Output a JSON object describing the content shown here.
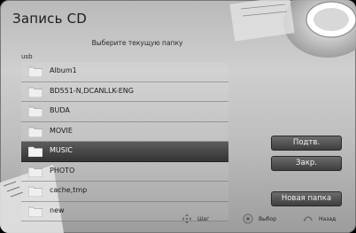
{
  "screen": {
    "title": "Запись CD",
    "subtitle": "Выберите текущую папку",
    "path": "usb"
  },
  "folders": [
    {
      "label": "Album1",
      "selected": false
    },
    {
      "label": "BD551-N,DCANLLK-ENG",
      "selected": false
    },
    {
      "label": "BUDA",
      "selected": false
    },
    {
      "label": "MOVIE",
      "selected": false
    },
    {
      "label": "MUSIC",
      "selected": true
    },
    {
      "label": "PHOTO",
      "selected": false
    },
    {
      "label": "cache,tmp",
      "selected": false
    },
    {
      "label": "new",
      "selected": false
    }
  ],
  "buttons": {
    "confirm": "Подтв.",
    "close": "Закр.",
    "new_folder": "Новая папка"
  },
  "hints": {
    "move": {
      "icon": "dpad-icon",
      "label": "Шаг"
    },
    "select": {
      "icon": "ok-icon",
      "label": "Выбор"
    },
    "back": {
      "icon": "return-icon",
      "label": "Назад"
    }
  },
  "colors": {
    "selected_row": "#3c3c3c",
    "button": "#4a4a4a",
    "background": "#c4c4c4"
  }
}
